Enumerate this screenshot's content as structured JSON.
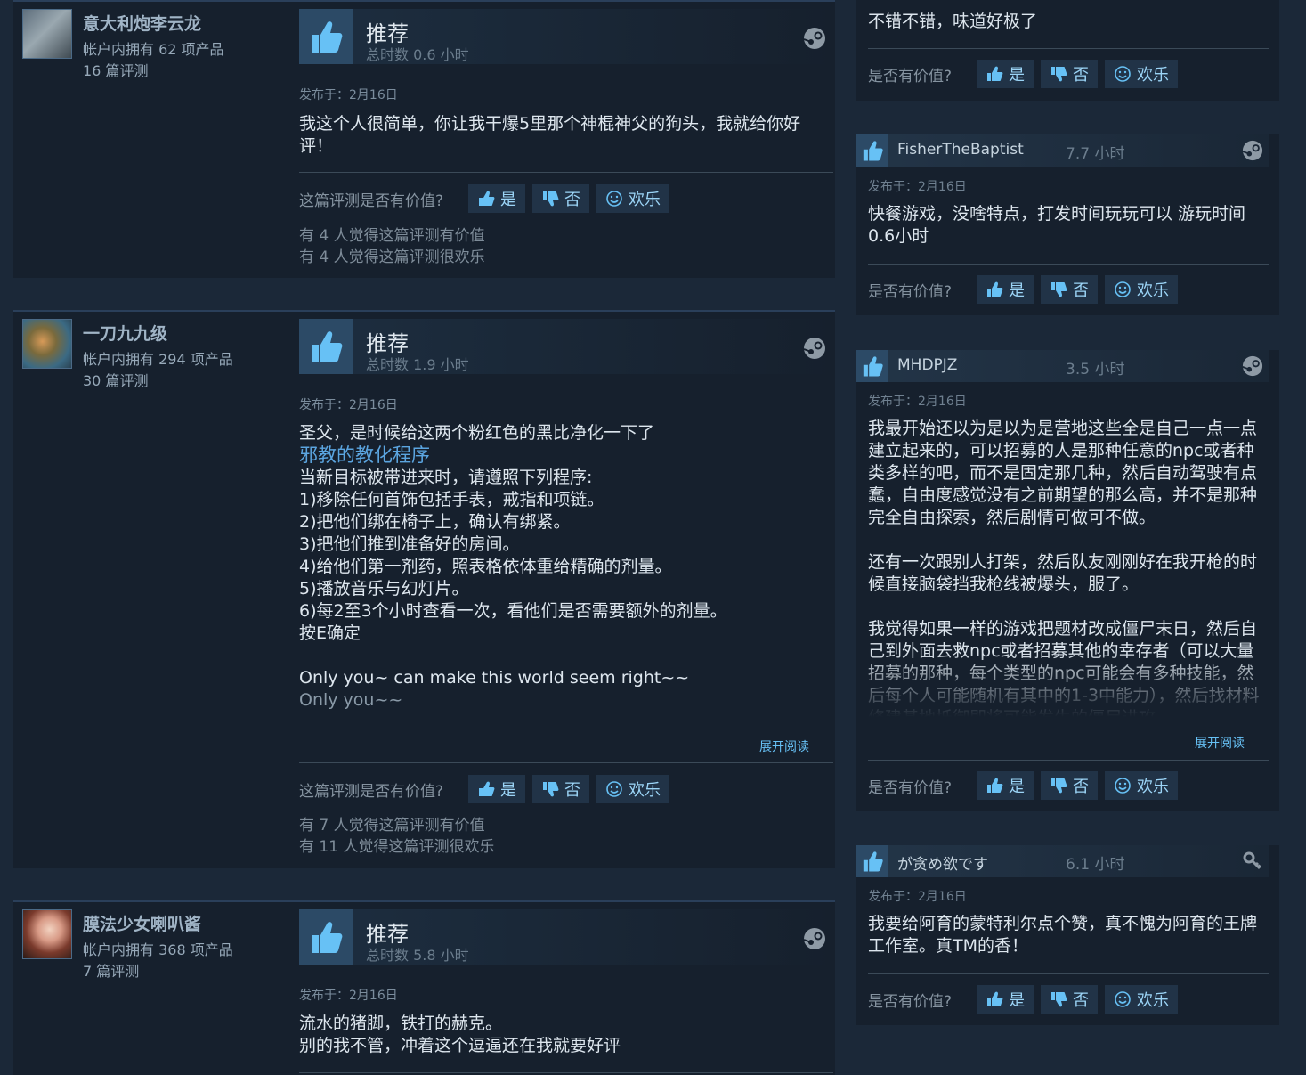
{
  "left_reviews": [
    {
      "author": "意大利炮李云龙",
      "products": "帐户内拥有 62 项产品",
      "review_count": "16 篇评测",
      "verdict": "推荐",
      "hours": "总时数 0.6 小时",
      "posted": "发布于：2月16日",
      "body_lines": [
        "我这个人很简单，你让我干爆5里那个神棍神父的狗头，我就给你好评！"
      ],
      "helpful_question": "这篇评测是否有价值?",
      "btn_yes": "是",
      "btn_no": "否",
      "btn_funny": "欢乐",
      "stat_helpful": "有 4 人觉得这篇评测有价值",
      "stat_funny": "有 4 人觉得这篇评测很欢乐"
    },
    {
      "author": "一刀九九级",
      "products": "帐户内拥有 294 项产品",
      "review_count": "30 篇评测",
      "verdict": "推荐",
      "hours": "总时数 1.9 小时",
      "posted": "发布于：2月16日",
      "line1": "圣父，是时候给这两个粉红色的黑比净化一下了",
      "highlight": "邪教的教化程序",
      "lines": [
        "当新目标被带进来时，请遵照下列程序:",
        "1)移除任何首饰包括手表，戒指和项链。",
        "2)把他们绑在椅子上，确认有绑紧。",
        "3)把他们推到准备好的房间。",
        "4)给他们第一剂药，照表格依体重给精确的剂量。",
        "5)播放音乐与幻灯片。",
        "6)每2至3个小时查看一次，看他们是否需要额外的剂量。",
        "按E确定"
      ],
      "song1": "Only you~ can make this world seem right~~",
      "song2": "Only you~~",
      "read_more": "展开阅读",
      "helpful_question": "这篇评测是否有价值?",
      "btn_yes": "是",
      "btn_no": "否",
      "btn_funny": "欢乐",
      "stat_helpful": "有 7 人觉得这篇评测有价值",
      "stat_funny": "有 11 人觉得这篇评测很欢乐"
    },
    {
      "author": "膜法少女喇叭酱",
      "products": "帐户内拥有 368 项产品",
      "review_count": "7 篇评测",
      "verdict": "推荐",
      "hours": "总时数 5.8 小时",
      "posted": "发布于：2月16日",
      "lines": [
        "流水的猪脚，铁打的赫克。",
        "别的我不管，冲着这个逗逼还在我就要好评"
      ]
    }
  ],
  "right_reviews": [
    {
      "body": "不错不错，味道好极了",
      "helpful_question": "是否有价值?",
      "btn_yes": "是",
      "btn_no": "否",
      "btn_funny": "欢乐"
    },
    {
      "author": "FisherTheBaptist",
      "hours": "7.7 小时",
      "posted": "发布于：2月16日",
      "body": "快餐游戏，没啥特点，打发时间玩玩可以 游玩时间0.6小时",
      "helpful_question": "是否有价值?",
      "btn_yes": "是",
      "btn_no": "否",
      "btn_funny": "欢乐"
    },
    {
      "author": "MHDPJZ",
      "hours": "3.5 小时",
      "posted": "发布于：2月16日",
      "para1": "我最开始还以为是以为是营地这些全是自己一点一点建立起来的，可以招募的人是那种任意的npc或者种类多样的吧，而不是固定那几种，然后自动驾驶有点蠢，自由度感觉没有之前期望的那么高，并不是那种完全自由探索，然后剧情可做可不做。",
      "para2": "还有一次跟别人打架，然后队友刚刚好在我开枪的时候直接脑袋挡我枪线被爆头，服了。",
      "para3": "我觉得如果一样的游戏把题材改成僵尸末日，然后自己到外面去救npc或者招募其他的幸存者（可以大量招募的那种，每个类型的npc可能会有多种技能，然后每个人可能随机有其中的1-3中能力），然后找材料修建基地抵御即将可能发生的僵尸进攻",
      "read_more": "展开阅读",
      "helpful_question": "是否有价值?",
      "btn_yes": "是",
      "btn_no": "否",
      "btn_funny": "欢乐"
    },
    {
      "author": "が贪め欲です",
      "hours": "6.1 小时",
      "posted": "发布于：2月16日",
      "body": "我要给阿育的蒙特利尔点个赞，真不愧为阿育的王牌工作室。真TM的香！",
      "helpful_question": "是否有价值?",
      "btn_yes": "是",
      "btn_no": "否",
      "btn_funny": "欢乐"
    }
  ],
  "icons": {
    "thumbs_up": "thumbs-up-icon",
    "thumbs_down": "thumbs-down-icon",
    "smile": "smile-icon",
    "steam": "steam-logo-icon",
    "key": "key-icon"
  },
  "colors": {
    "background": "#1b2838",
    "card": "#16202d",
    "accent_blue": "#67c1f5",
    "highlight_link": "#5ba5e0"
  }
}
